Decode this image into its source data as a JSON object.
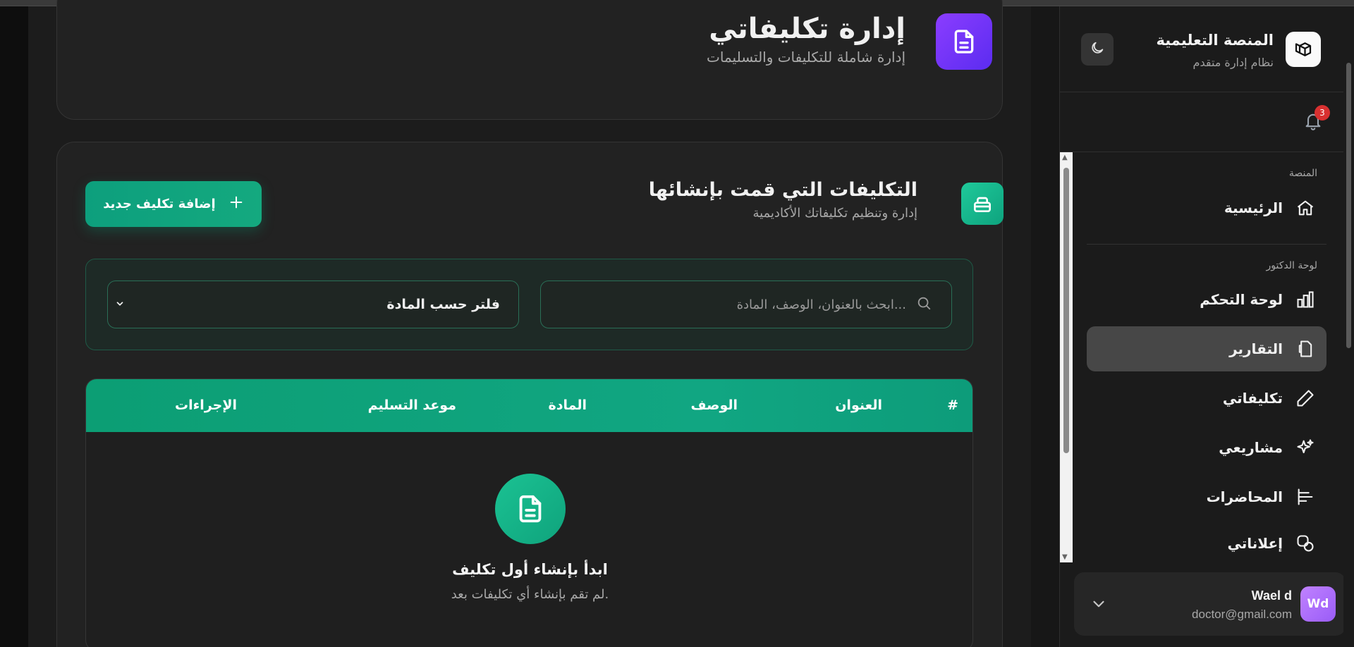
{
  "page": {
    "title": "إدارة تكليفاتي",
    "subtitle": "إدارة شاملة للتكليفات والتسليمات"
  },
  "assignments": {
    "title": "التكليفات التي قمت بإنشائها",
    "subtitle": "إدارة وتنظيم تكليفاتك الأكاديمية",
    "add_button": "إضافة تكليف جديد",
    "search_placeholder": "ابحث بالعنوان، الوصف، المادة...",
    "filter_label": "فلتر حسب المادة",
    "table": {
      "columns": [
        "#",
        "العنوان",
        "الوصف",
        "المادة",
        "موعد التسليم",
        "الإجراءات"
      ]
    },
    "empty": {
      "title": "ابدأ بإنشاء أول تكليف",
      "subtitle": "لم تقم بإنشاء أي تكليفات بعد."
    }
  },
  "sidebar": {
    "brand_name": "المنصة التعليمية",
    "brand_sub": "نظام إدارة متقدم",
    "notification_count": "3",
    "section_platform": "المنصة",
    "section_doctor": "لوحة الدكتور",
    "items": [
      {
        "label": "الرئيسية",
        "icon": "home-icon"
      },
      {
        "label": "لوحة التحكم",
        "icon": "chart-icon"
      },
      {
        "label": "التقارير",
        "icon": "report-icon",
        "active": true
      },
      {
        "label": "تكليفاتي",
        "icon": "pencil-icon"
      },
      {
        "label": "مشاريعي",
        "icon": "sparkles-icon"
      },
      {
        "label": "المحاضرات",
        "icon": "lectures-icon"
      },
      {
        "label": "إعلاناتي",
        "icon": "announcements-icon"
      }
    ],
    "user": {
      "initials": "Wd",
      "name": "Wael d",
      "email": "doctor@gmail.com"
    }
  },
  "colors": {
    "accent_green": "#11a682",
    "accent_purple": "#6e33f5",
    "badge_red": "#d83030"
  }
}
